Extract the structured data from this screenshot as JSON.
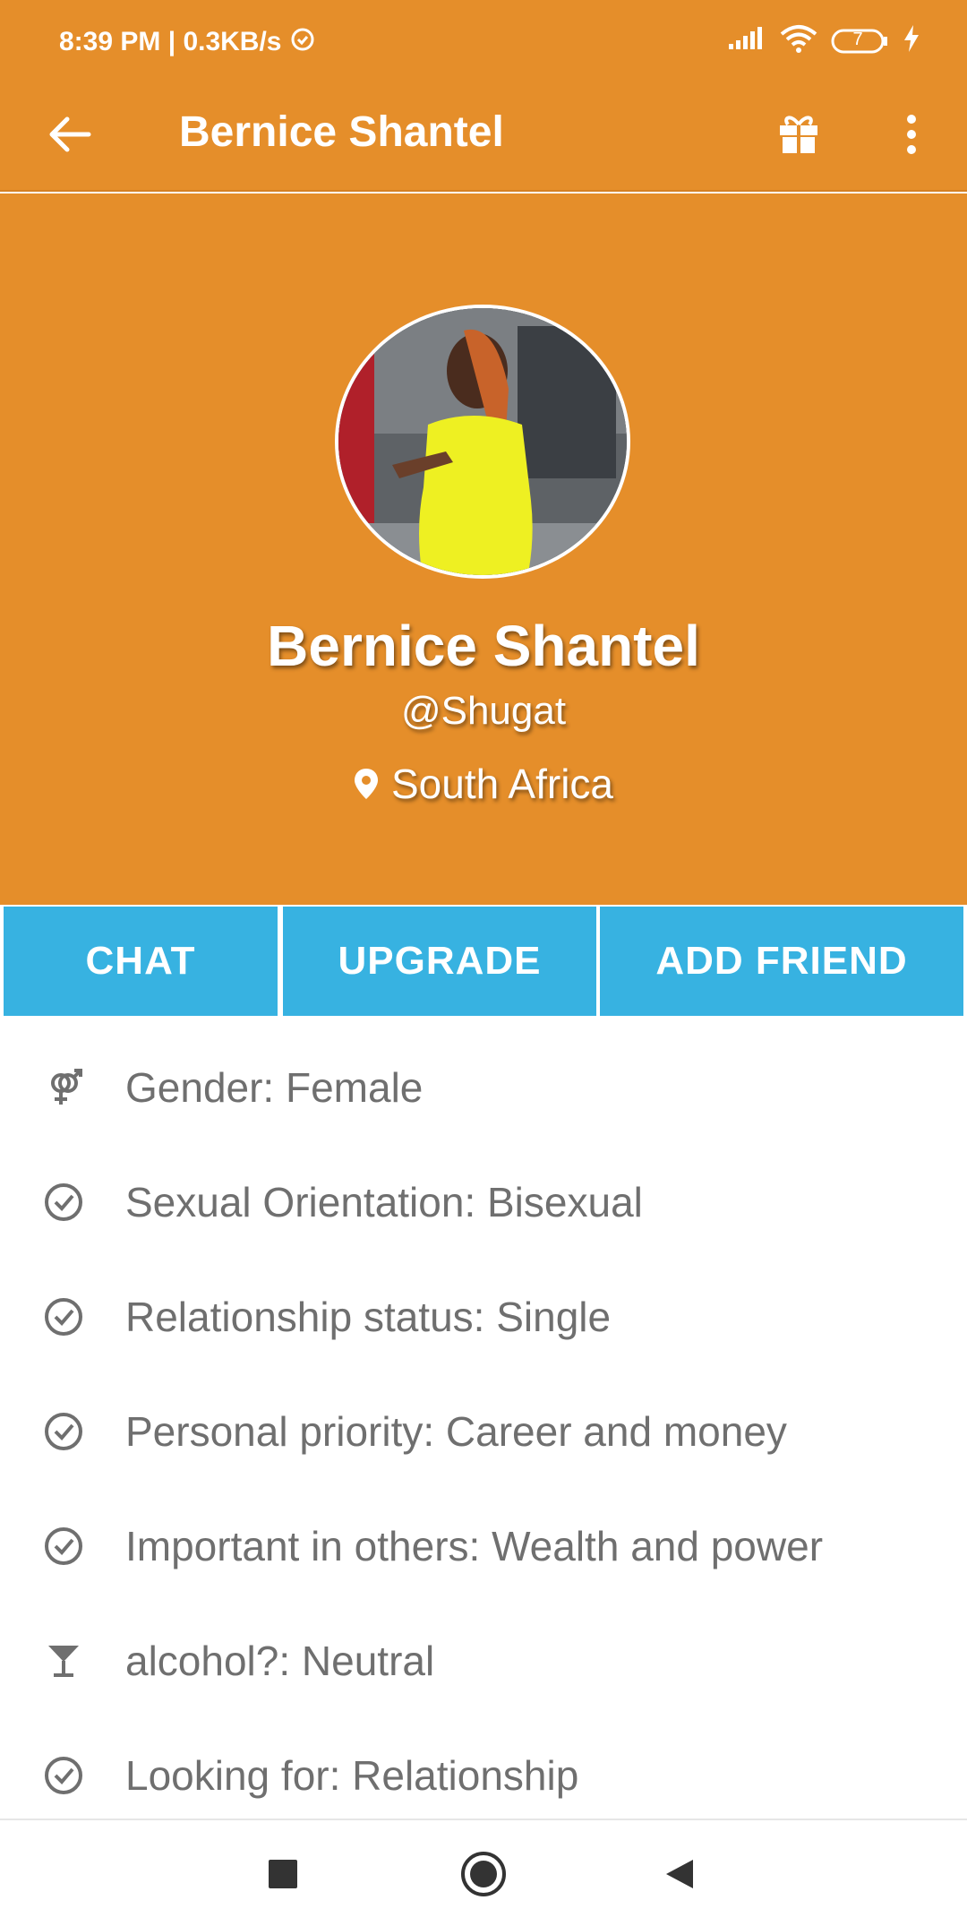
{
  "status_bar": {
    "time_speed": "8:39 PM | 0.3KB/s",
    "battery": "7"
  },
  "app_bar": {
    "title": "Bernice Shantel"
  },
  "profile": {
    "name": "Bernice Shantel",
    "handle": "@Shugat",
    "location": "South Africa"
  },
  "actions": {
    "chat": "CHAT",
    "upgrade": "UPGRADE",
    "add_friend": "ADD FRIEND"
  },
  "details": [
    {
      "icon": "gender-icon",
      "text": "Gender: Female"
    },
    {
      "icon": "check-circle-icon",
      "text": "Sexual Orientation: Bisexual"
    },
    {
      "icon": "check-circle-icon",
      "text": "Relationship status: Single"
    },
    {
      "icon": "check-circle-icon",
      "text": "Personal priority: Career and money"
    },
    {
      "icon": "check-circle-icon",
      "text": "Important in others: Wealth and power"
    },
    {
      "icon": "cocktail-icon",
      "text": "alcohol?: Neutral"
    },
    {
      "icon": "check-circle-icon",
      "text": "Looking for: Relationship"
    }
  ],
  "colors": {
    "header_orange": "#E58E2A",
    "button_blue": "#37B2E1",
    "detail_text": "#6f6f6f"
  }
}
